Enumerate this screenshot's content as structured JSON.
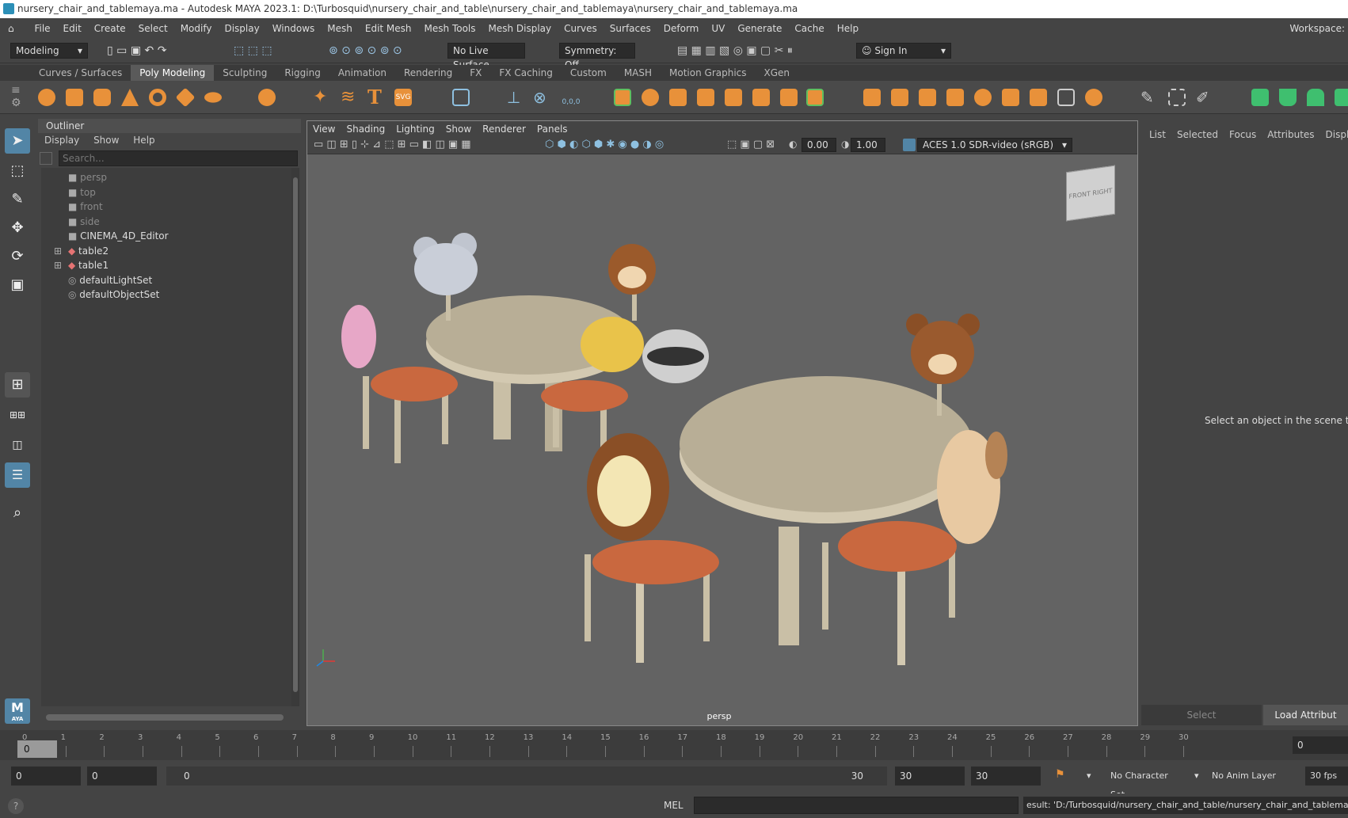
{
  "window": {
    "title": "nursery_chair_and_tablemaya.ma - Autodesk MAYA 2023.1: D:\\Turbosquid\\nursery_chair_and_table\\nursery_chair_and_tablemaya\\nursery_chair_and_tablemaya.ma"
  },
  "menu": [
    "File",
    "Edit",
    "Create",
    "Select",
    "Modify",
    "Display",
    "Windows",
    "Mesh",
    "Edit Mesh",
    "Mesh Tools",
    "Mesh Display",
    "Curves",
    "Surfaces",
    "Deform",
    "UV",
    "Generate",
    "Cache",
    "Help"
  ],
  "workspace_label": "Workspace:",
  "status": {
    "menuset": "Modeling",
    "live_surface": "No Live Surface",
    "symmetry": "Symmetry: Off",
    "sign_in": "Sign In"
  },
  "shelf_tabs": [
    "Curves / Surfaces",
    "Poly Modeling",
    "Sculpting",
    "Rigging",
    "Animation",
    "Rendering",
    "FX",
    "FX Caching",
    "Custom",
    "MASH",
    "Motion Graphics",
    "XGen"
  ],
  "shelf_active": "Poly Modeling",
  "shelf_svg_label": "SVG",
  "shelf_coord_label": "0,0,0",
  "outliner": {
    "title": "Outliner",
    "menu": [
      "Display",
      "Show",
      "Help"
    ],
    "search_placeholder": "Search...",
    "items": [
      {
        "label": "persp",
        "dim": true,
        "type": "camera"
      },
      {
        "label": "top",
        "dim": true,
        "type": "camera"
      },
      {
        "label": "front",
        "dim": true,
        "type": "camera"
      },
      {
        "label": "side",
        "dim": true,
        "type": "camera"
      },
      {
        "label": "CINEMA_4D_Editor",
        "dim": false,
        "type": "camera"
      },
      {
        "label": "table2",
        "dim": false,
        "type": "transform"
      },
      {
        "label": "table1",
        "dim": false,
        "type": "transform"
      },
      {
        "label": "defaultLightSet",
        "dim": false,
        "type": "set"
      },
      {
        "label": "defaultObjectSet",
        "dim": false,
        "type": "set"
      }
    ]
  },
  "viewport": {
    "menu": [
      "View",
      "Shading",
      "Lighting",
      "Show",
      "Renderer",
      "Panels"
    ],
    "exposure": "0.00",
    "gamma": "1.00",
    "colorspace": "ACES 1.0 SDR-video (sRGB)",
    "camera_label": "persp",
    "viewcube_front": "FRONT",
    "viewcube_right": "RIGHT"
  },
  "attribute_editor": {
    "tabs": [
      "List",
      "Selected",
      "Focus",
      "Attributes",
      "Display"
    ],
    "message": "Select an object in the scene to vie",
    "select_button": "Select",
    "load_button": "Load Attribut"
  },
  "timeline": {
    "ticks": [
      "0",
      "1",
      "2",
      "3",
      "4",
      "5",
      "6",
      "7",
      "8",
      "9",
      "10",
      "11",
      "12",
      "13",
      "14",
      "15",
      "16",
      "17",
      "18",
      "19",
      "20",
      "21",
      "22",
      "23",
      "24",
      "25",
      "26",
      "27",
      "28",
      "29",
      "30"
    ],
    "current_frame": "0",
    "current_field": "0"
  },
  "range": {
    "start": "0",
    "playback_start": "0",
    "slider_start": "0",
    "slider_end": "30",
    "playback_end": "30",
    "end": "30",
    "character_set": "No Character Set",
    "anim_layer": "No Anim Layer",
    "fps": "30 fps"
  },
  "command": {
    "lang": "MEL",
    "result": "esult: 'D:/Turbosquid/nursery_chair_and_table/nursery_chair_and_tablemaya/n"
  },
  "toolbox_logo": {
    "letter": "M",
    "sub": "AYA"
  },
  "colors": {
    "accent": "#5285a6",
    "shelf_orange": "#e8913a",
    "bg": "#444444",
    "viewport": "#636363"
  }
}
